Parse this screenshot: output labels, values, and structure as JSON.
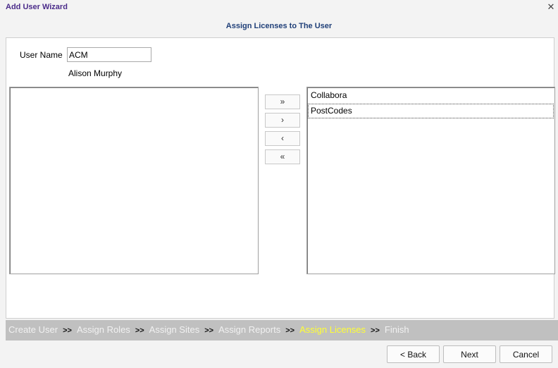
{
  "window": {
    "title": "Add User Wizard",
    "close_glyph": "✕",
    "subtitle": "Assign Licenses to The User"
  },
  "user": {
    "label": "User Name",
    "value": "ACM",
    "full_name": "Alison Murphy"
  },
  "available_licenses": [],
  "assigned_licenses": [
    "Collabora",
    "PostCodes"
  ],
  "transfer_buttons": {
    "add_all": "»",
    "add": "›",
    "remove": "‹",
    "remove_all": "«"
  },
  "steps": {
    "separator": ">>",
    "items": [
      "Create User",
      "Assign Roles",
      "Assign Sites",
      "Assign Reports",
      "Assign Licenses",
      "Finish"
    ],
    "active_index": 4
  },
  "footer": {
    "back": "< Back",
    "next": "Next",
    "cancel": "Cancel"
  },
  "colors": {
    "title": "#4b2c8a",
    "subtitle": "#1f3f78",
    "step_active": "#ffff33",
    "step_inactive": "#f1f1f1",
    "step_bar": "#c0c0c0"
  }
}
